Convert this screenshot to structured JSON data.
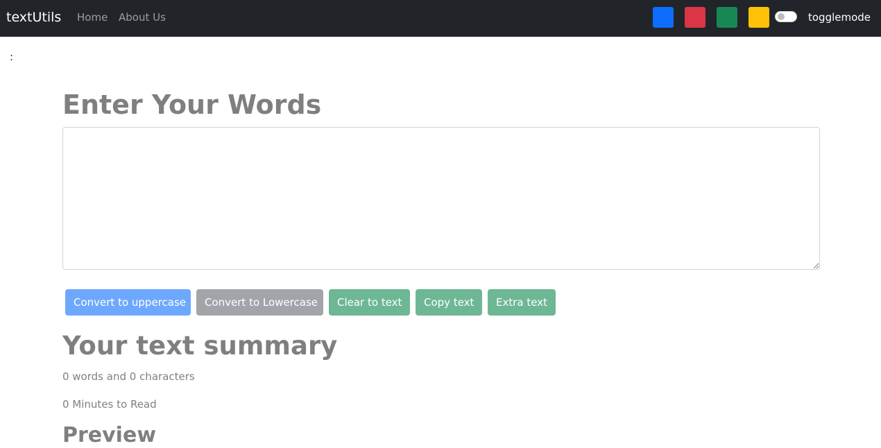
{
  "navbar": {
    "brand": "textUtils",
    "links": [
      {
        "label": "Home"
      },
      {
        "label": "About Us"
      }
    ],
    "swatches": [
      {
        "name": "blue",
        "color": "#0d6efd"
      },
      {
        "name": "red",
        "color": "#dc3545"
      },
      {
        "name": "green",
        "color": "#198754"
      },
      {
        "name": "yellow",
        "color": "#ffc107"
      }
    ],
    "toggle_label": "togglemode"
  },
  "alert_text": ":",
  "main": {
    "heading": "Enter Your Words",
    "textarea_value": "",
    "buttons": {
      "uppercase": "Convert to uppercase",
      "lowercase": "Convert to Lowercase",
      "clear": "Clear to text",
      "copy": "Copy text",
      "extra": "Extra text"
    }
  },
  "summary": {
    "heading": "Your text summary",
    "words_chars": "0 words and 0 characters",
    "read_time": "0 Minutes to Read",
    "preview_heading": "Preview"
  }
}
